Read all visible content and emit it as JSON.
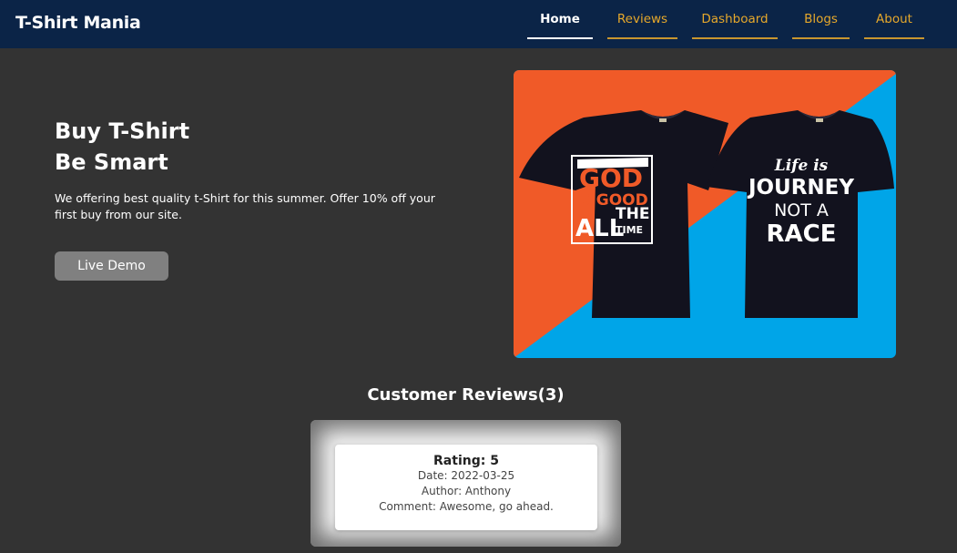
{
  "navbar": {
    "brand": "T-Shirt Mania",
    "links": [
      "Home",
      "Reviews",
      "Dashboard",
      "Blogs",
      "About"
    ],
    "active": "Home"
  },
  "hero": {
    "title_line1": "Buy T-Shirt",
    "title_line2": "Be Smart",
    "description": "We offering best quality t-Shirt for this summer. Offer 10% off your first buy from our site.",
    "button_label": "Live Demo",
    "image": {
      "shirt1": [
        "GOD",
        "IS GOOD",
        "ALL",
        "THE",
        "TIME"
      ],
      "shirt2": [
        "Life is",
        "JOURNEY",
        "NOT A",
        "RACE"
      ]
    }
  },
  "reviews": {
    "heading": "Customer Reviews(3)",
    "items": [
      {
        "rating": "Rating: 5",
        "date": "Date: 2022-03-25",
        "author": "Author: Anthony",
        "comment": "Comment: Awesome, go ahead."
      }
    ]
  },
  "colors": {
    "background": "#333333",
    "navbar": "#0b2447",
    "nav_accent": "#e6a82b",
    "hero_orange": "#f05a28",
    "hero_blue": "#00a5e8"
  }
}
